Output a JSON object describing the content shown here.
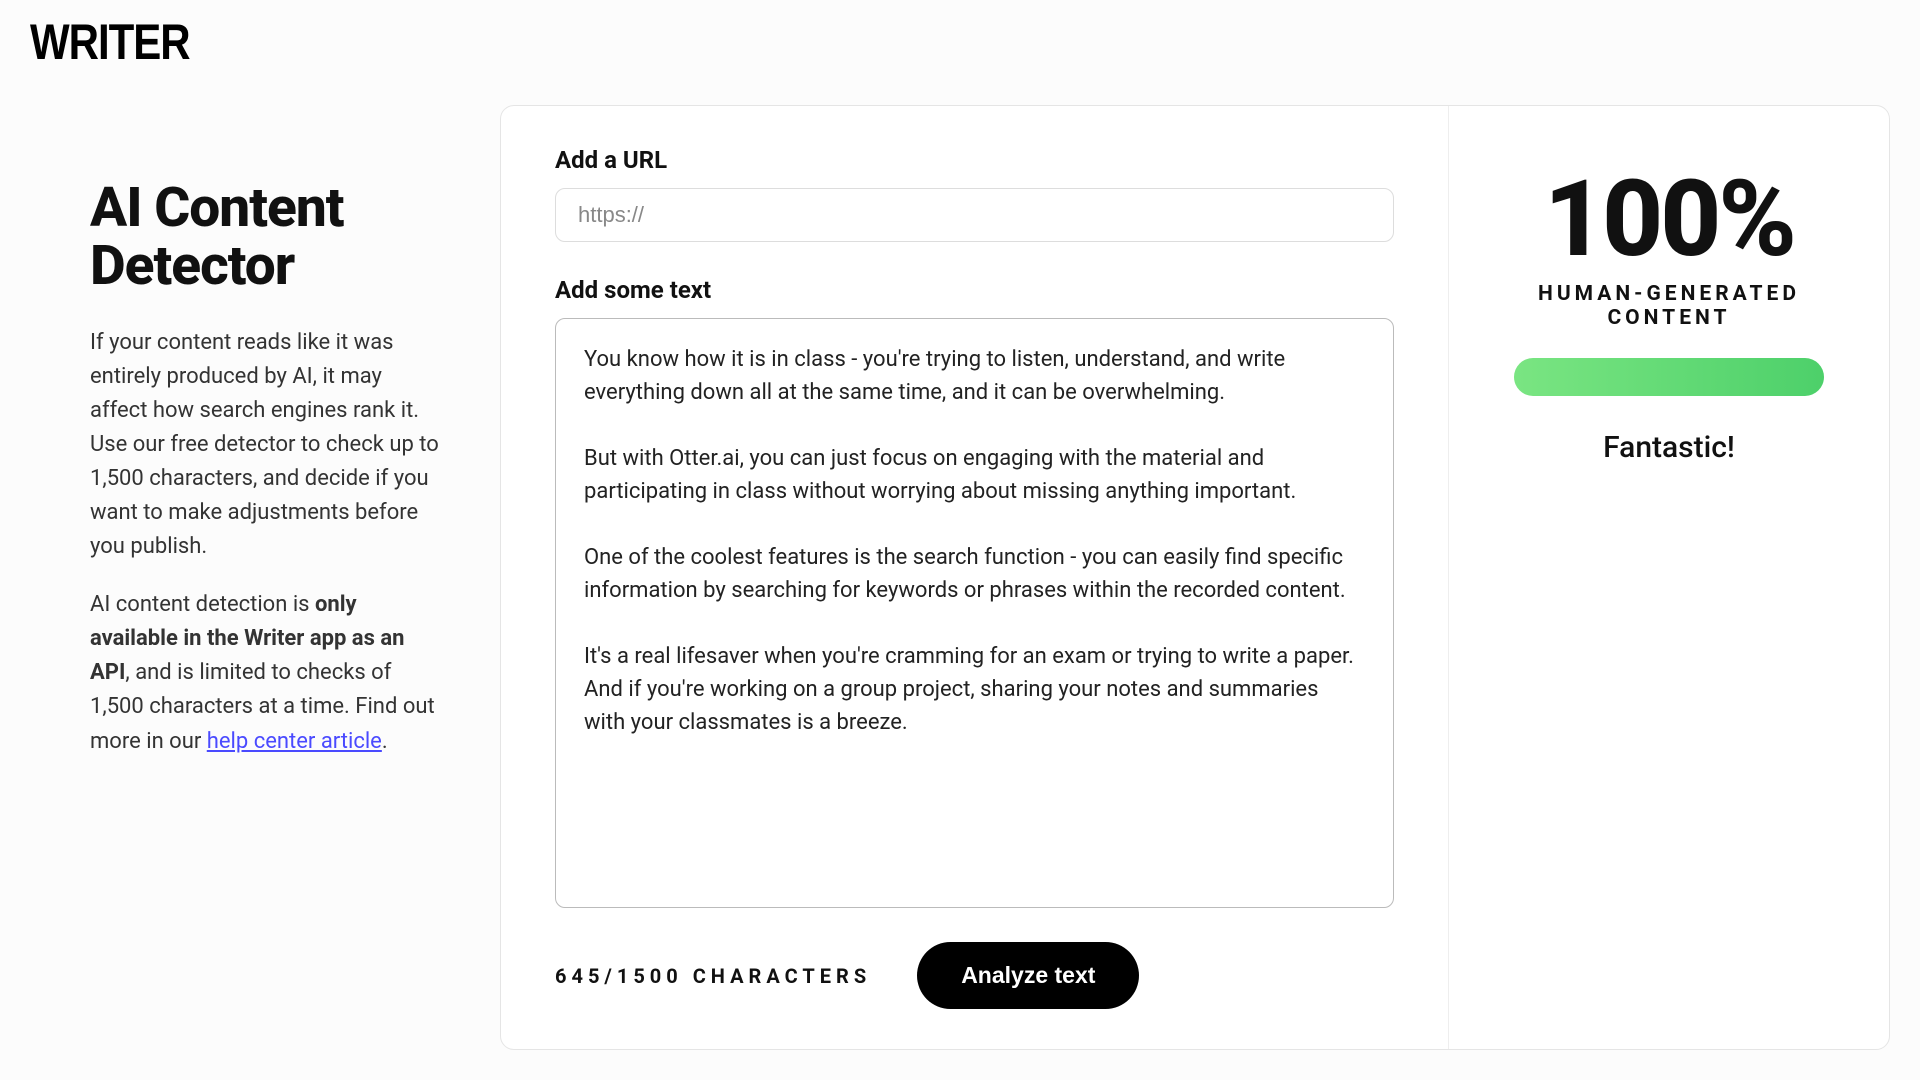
{
  "logo": "WRITER",
  "left": {
    "title": "AI Content Detector",
    "description1": "If your content reads like it was entirely produced by AI, it may affect how search engines rank it. Use our free detector to check up to 1,500 characters, and decide if you want to make adjustments before you publish.",
    "desc2_prefix": "AI content detection is ",
    "desc2_bold": "only available in the Writer app as an API",
    "desc2_mid": ", and is limited to checks of 1,500 characters at a time. Find out more in our ",
    "desc2_link": "help center article",
    "desc2_suffix": "."
  },
  "center": {
    "url_label": "Add a URL",
    "url_placeholder": "https://",
    "url_value": "",
    "text_label": "Add some text",
    "text_value": "You know how it is in class - you're trying to listen, understand, and write everything down all at the same time, and it can be overwhelming.\n\nBut with Otter.ai, you can just focus on engaging with the material and participating in class without worrying about missing anything important.\n\nOne of the coolest features is the search function - you can easily find specific information by searching for keywords or phrases within the recorded content.\n\nIt's a real lifesaver when you're cramming for an exam or trying to write a paper. And if you're working on a group project, sharing your notes and summaries with your classmates is a breeze.",
    "char_count": "645/1500 CHARACTERS",
    "analyze_button": "Analyze text"
  },
  "right": {
    "score": "100%",
    "score_label": "HUMAN-GENERATED CONTENT",
    "progress_percent": 100,
    "verdict": "Fantastic!"
  }
}
